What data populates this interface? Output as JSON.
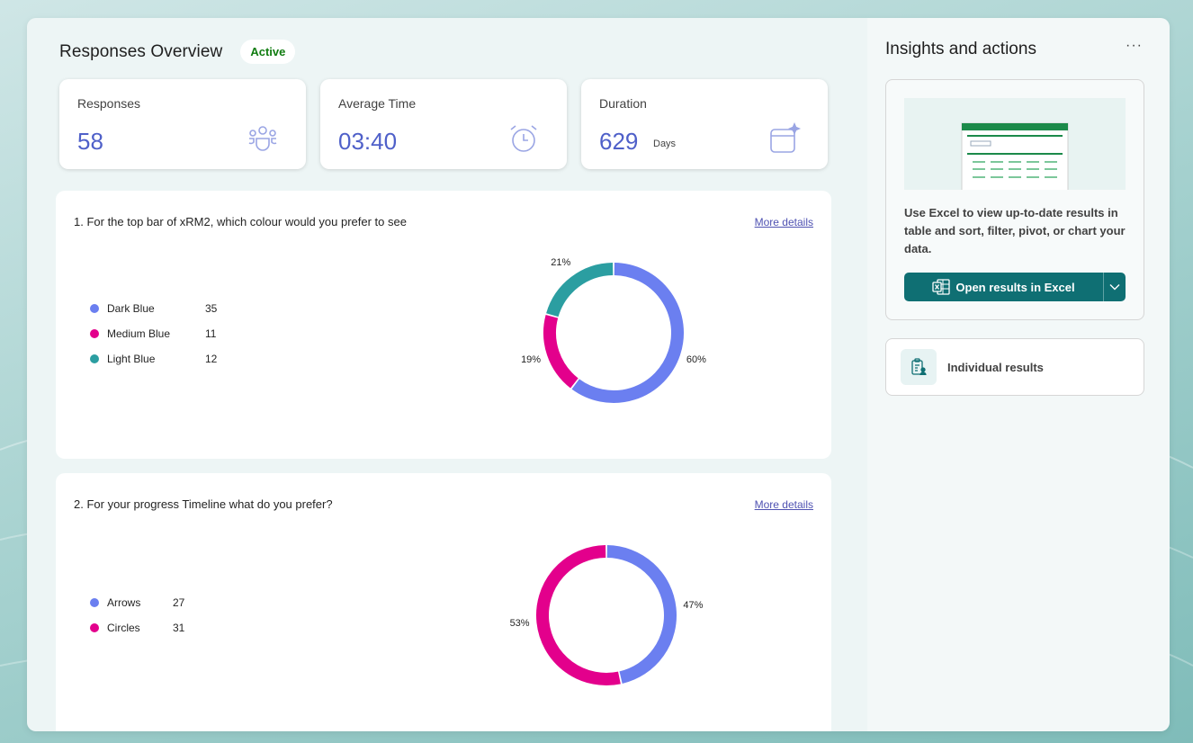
{
  "overview": {
    "title": "Responses Overview",
    "status": "Active"
  },
  "stats": [
    {
      "label": "Responses",
      "value": "58",
      "unit": "",
      "icon": "people-group-icon"
    },
    {
      "label": "Average Time",
      "value": "03:40",
      "unit": "",
      "icon": "alarm-clock-icon"
    },
    {
      "label": "Duration",
      "value": "629",
      "unit": "Days",
      "icon": "calendar-sparkle-icon"
    }
  ],
  "questions": [
    {
      "title": "1. For the top bar of xRM2, which colour would you prefer to see",
      "more_details": "More details",
      "chart_data": {
        "type": "pie",
        "categories": [
          "Dark Blue",
          "Medium Blue",
          "Light Blue"
        ],
        "values": [
          35,
          11,
          12
        ],
        "percent_labels": [
          "60%",
          "19%",
          "21%"
        ],
        "colors": [
          "#6b7ff0",
          "#e3008c",
          "#2b9ea1"
        ]
      }
    },
    {
      "title": "2. For your progress Timeline what do you prefer?",
      "more_details": "More details",
      "chart_data": {
        "type": "pie",
        "categories": [
          "Arrows",
          "Circles"
        ],
        "values": [
          27,
          31
        ],
        "percent_labels": [
          "47%",
          "53%"
        ],
        "colors": [
          "#6b7ff0",
          "#e3008c"
        ]
      }
    }
  ],
  "sidebar": {
    "title": "Insights and actions",
    "more_label": "···",
    "excel_description": "Use Excel to view up-to-date results in table and sort, filter, pivot, or chart your data.",
    "excel_button": "Open results in Excel",
    "individual_results": "Individual results"
  },
  "colors": {
    "accent": "#4f60c9",
    "excel_button": "#0f6f73",
    "active_green": "#107c10"
  }
}
